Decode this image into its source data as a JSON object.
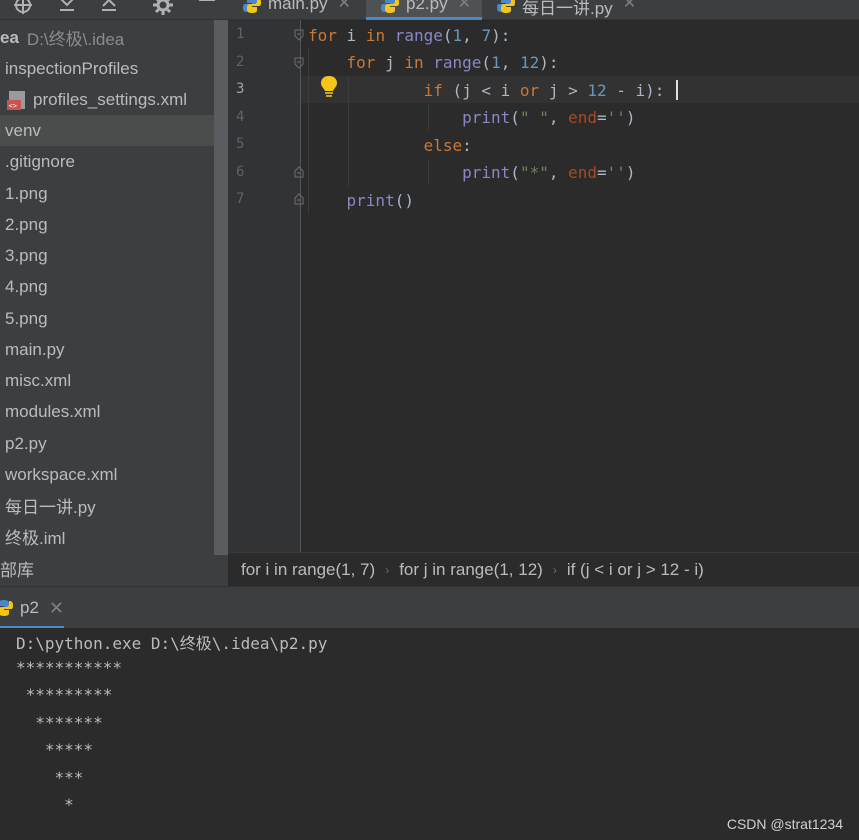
{
  "tabs": [
    {
      "label": "main.py",
      "active": false
    },
    {
      "label": "p2.py",
      "active": true
    },
    {
      "label": "每日一讲.py",
      "active": false
    }
  ],
  "project": {
    "root_name": "ea",
    "root_path": "D:\\终极\\.idea",
    "items": [
      {
        "label": "inspectionProfiles"
      },
      {
        "label": "profiles_settings.xml"
      },
      {
        "label": "venv"
      },
      {
        "label": ".gitignore"
      },
      {
        "label": "1.png"
      },
      {
        "label": "2.png"
      },
      {
        "label": "3.png"
      },
      {
        "label": "4.png"
      },
      {
        "label": "5.png"
      },
      {
        "label": "main.py"
      },
      {
        "label": "misc.xml"
      },
      {
        "label": "modules.xml"
      },
      {
        "label": "p2.py"
      },
      {
        "label": "workspace.xml"
      },
      {
        "label": "每日一讲.py"
      },
      {
        "label": "终极.iml"
      }
    ],
    "external_libs": "部库"
  },
  "editor": {
    "line_numbers": [
      "1",
      "2",
      "3",
      "4",
      "5",
      "6",
      "7"
    ],
    "current_line": 3
  },
  "breadcrumb": {
    "items": [
      "for i in range(1, 7)",
      "for j in range(1, 12)",
      "if (j < i or j > 12 - i)"
    ]
  },
  "run": {
    "tab_label": "p2",
    "command": "D:\\python.exe D:\\终极\\.idea\\p2.py",
    "output": [
      "***********",
      " *********",
      "  *******",
      "   *****",
      "    ***",
      "     *"
    ]
  },
  "watermark": "CSDN @strat1234",
  "colors": {
    "accent": "#4a88c7",
    "keyword": "#cc7832",
    "number": "#6897bb",
    "string": "#6a8759",
    "builtin": "#8888c6",
    "bulb": "#f5c518"
  }
}
